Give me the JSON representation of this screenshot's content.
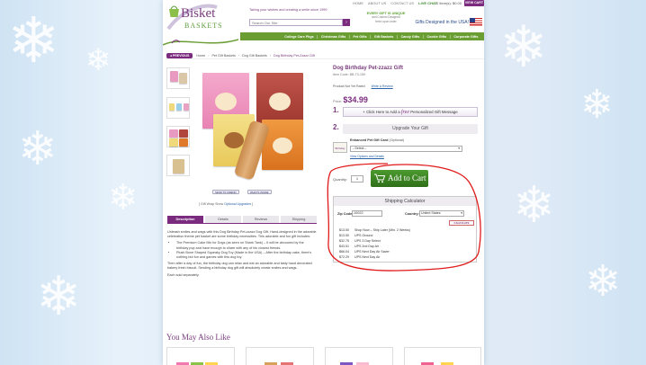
{
  "header": {
    "top_links": [
      "HOME",
      "ABOUT US",
      "CONTACT US",
      "LIVE CHAT"
    ],
    "cart_info": "0 Item(s): $0.00",
    "view_cart": "VIEW CART",
    "logo_line1": "Bisket",
    "logo_line2": "BASKETS",
    "tagline": "Taking your wishes and creating a smile since 1999",
    "search_placeholder": "Search Our Site",
    "promo_line1": "EVERY GIFT IS UNIQUE",
    "promo_line2": "and Custom Designed",
    "promo_line3": "fresh upon order",
    "usa_text": "Gifts Designed in the USA!"
  },
  "nav": [
    "College Care Pkgs",
    "Christmas Gifts",
    "Pet Gifts",
    "Gift Baskets",
    "Candy Gifts",
    "Cookie Gifts",
    "Corporate Gifts"
  ],
  "breadcrumb": {
    "previous": "PREVIOUS",
    "items": [
      "Home",
      "Pet Gift Baskets",
      "Dog Gift Baskets",
      "Dog Birthday Pet-Zzazz Gift"
    ]
  },
  "image_buttons": [
    "SEND TO FRIEND",
    "WHAT'S INSIDE"
  ],
  "gift_wrap": {
    "prefix": "Gift Wrap Show",
    "option": "Optional Upgrades"
  },
  "tabs": [
    "Description",
    "Details",
    "Reviews",
    "Shipping"
  ],
  "description": {
    "intro": "Unleash smiles and wags with this Dog Birthday Pet-zzazz Dog Gift. Hand-designed in the adorable celebration theme pet basket are some birthday necessities. This adorable and fun gift includes:",
    "bullets": [
      "The Premium Cake Mix for Dogs (as seen on Shark Tank) – It will be devoured by the birthday pup and have enough to share with any of his closest friends.",
      "Plush Bone Shaped Squeaky Dog Toy (Made in the USA) – After the birthday cake, there's nothing but fun and games with this dog toy."
    ],
    "outro": "Then after a day of fun, the birthday dog can relax and eat an adorable and tasty hand decorated bakery fresh biscuit. Sending a birthday dog gift will absolutely create smiles and wags.",
    "note": "Each sold separately."
  },
  "product": {
    "title": "Dog Birthday Pet-zzazz Gift",
    "item_code": "Item Code: BB-T3-159",
    "rating": "Product Not Yet Rated",
    "review_link": "Write a Review",
    "price_label": "Price:",
    "price": "$34.99",
    "step1": "1.",
    "step2": "2.",
    "gift_msg_pre": "+ Click Here to Add a",
    "gift_msg_free": "free",
    "gift_msg_post": "Personalized Gift Message",
    "upgrade": "Upgrade Your Gift",
    "card_thumb": "Birthday",
    "card_label_bold": "Enhanced Pet Gift Card",
    "card_label_opt": "(Optional)",
    "card_select": "--Select--",
    "card_link": "View Options and Details",
    "qty_label": "Quantity:",
    "qty": "1",
    "add_to_cart": "Add to Cart"
  },
  "shipping": {
    "title": "Shipping Calculator",
    "zip_label": "Zip Code:",
    "zip": "10022",
    "country_label": "Country:",
    "country": "United States",
    "calc_button": "CALCULATE",
    "rates": [
      {
        "price": "$13.50",
        "name": "Shop Now – Ship Later (Min. 2 Weeks)"
      },
      {
        "price": "$13.50",
        "name": "UPS Ground"
      },
      {
        "price": "$32.75",
        "name": "UPS 3 Day Select"
      },
      {
        "price": "$43.51",
        "name": "UPS 2nd Day Air"
      },
      {
        "price": "$66.04",
        "name": "UPS Next Day Air Saver"
      },
      {
        "price": "$72.29",
        "name": "UPS Next Day Air"
      }
    ]
  },
  "also_like": "You May Also Like",
  "colors": {
    "brand_purple": "#7a2b7e",
    "nav_green": "#6a9e33",
    "cart_green": "#3f8a25",
    "annotation_red": "#e01a1a"
  }
}
